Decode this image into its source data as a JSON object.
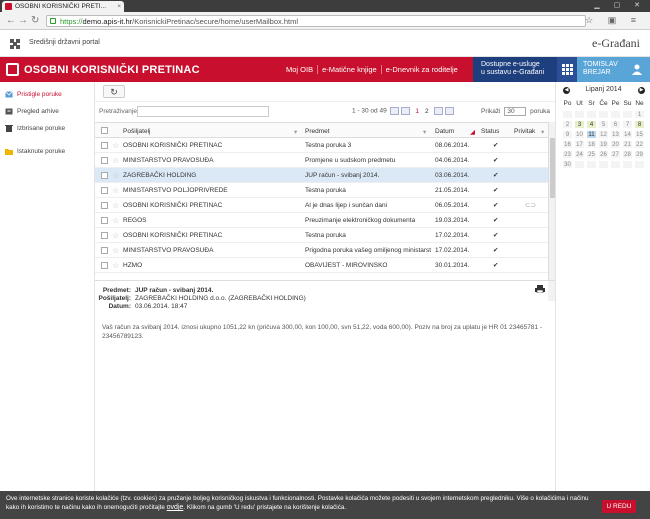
{
  "browser": {
    "tab_title": "OSOBNI KORISNIČKI PRETI...",
    "url_scheme": "https://",
    "url_host": "demo.apis-it.hr",
    "url_path": "/KorisnickiPretinac/secure/home/userMailbox.html"
  },
  "portal": {
    "name": "Središnji državni portal",
    "brand": "e-Građani"
  },
  "header": {
    "title": "OSOBNI KORISNIČKI PRETINAC",
    "links": [
      "Moj OIB",
      "e-Matične knjige",
      "e-Dnevnik za roditelje"
    ],
    "services_line1": "Dostupne e-usluge",
    "services_line2": "u sustavu e-Građani",
    "user_first": "TOMISLAV",
    "user_last": "BREJAR"
  },
  "sidebar": {
    "items": [
      {
        "label": "Pristigle poruke",
        "icon": "envelope-icon"
      },
      {
        "label": "Pregled arhive",
        "icon": "archive-icon"
      },
      {
        "label": "Izbrisane poruke",
        "icon": "trash-icon"
      },
      {
        "label": "Istaknute poruke",
        "icon": "folder-icon"
      }
    ]
  },
  "search": {
    "label": "Pretraživanje:",
    "placeholder": ""
  },
  "pager": {
    "range": "1 - 30 od 49",
    "page1": "1",
    "page2": "2",
    "show_label": "Prikaži",
    "show_value": "30",
    "show_unit": "poruka"
  },
  "table": {
    "columns": [
      "Pošiljatelj",
      "Predmet",
      "Datum",
      "Status",
      "Privitak"
    ],
    "rows": [
      {
        "sender": "OSOBNI KORISNIČKI PRETINAC",
        "subject": "Testna poruka 3",
        "date": "08.06.2014.",
        "status": "✔",
        "attach": "",
        "selected": false
      },
      {
        "sender": "MINISTARSTVO PRAVOSUĐA",
        "subject": "Promjene u sudskom predmetu",
        "date": "04.06.2014.",
        "status": "✔",
        "attach": "",
        "selected": false
      },
      {
        "sender": "ZAGREBAČKI HOLDING",
        "subject": "JUP račun - svibanj 2014.",
        "date": "03.06.2014.",
        "status": "✔",
        "attach": "",
        "selected": true
      },
      {
        "sender": "MINISTARSTVO POLJOPRIVREDE",
        "subject": "Testna poruka",
        "date": "21.05.2014.",
        "status": "✔",
        "attach": "",
        "selected": false
      },
      {
        "sender": "OSOBNI KORISNIČKI PRETINAC",
        "subject": "Al je dnas lijep i sunčan dani",
        "date": "06.05.2014.",
        "status": "✔",
        "attach": "⊂⊃",
        "selected": false
      },
      {
        "sender": "REGOS",
        "subject": "Preuzimanje elektroničkog dokumenta",
        "date": "19.03.2014.",
        "status": "✔",
        "attach": "",
        "selected": false
      },
      {
        "sender": "OSOBNI KORISNIČKI PRETINAC",
        "subject": "Testna poruka",
        "date": "17.02.2014.",
        "status": "✔",
        "attach": "",
        "selected": false
      },
      {
        "sender": "MINISTARSTVO PRAVOSUĐA",
        "subject": "Prigodna poruka vašeg omiljenog ministarstva",
        "date": "17.02.2014.",
        "status": "✔",
        "attach": "",
        "selected": false
      },
      {
        "sender": "HZMO",
        "subject": "OBAVIJEST - MIROVINSKO",
        "date": "30.01.2014.",
        "status": "✔",
        "attach": "",
        "selected": false
      }
    ]
  },
  "preview": {
    "subject_label": "Predmet:",
    "subject": "JUP račun - svibanj 2014.",
    "sender_label": "Pošiljatelj:",
    "sender": "ZAGREBAČKI HOLDING d.o.o. (ZAGREBAČKI HOLDING)",
    "date_label": "Datum:",
    "date": "03.06.2014. 18:47",
    "body": "Vaš račun za svibanj 2014. iznosi ukupno 1051,22 kn (pričuva 300,00, kon 100,00, svn 51,22, voda 600,00). Poziv na broj za uplatu je HR 01 23465781 - 23456789123."
  },
  "calendar": {
    "month": "Lipanj 2014",
    "days": [
      "Po",
      "Ut",
      "Sr",
      "Če",
      "Pe",
      "Su",
      "Ne"
    ],
    "weeks": [
      [
        "",
        "",
        "",
        "",
        "",
        "",
        "1"
      ],
      [
        "2",
        "3",
        "4",
        "5",
        "6",
        "7",
        "8"
      ],
      [
        "9",
        "10",
        "11",
        "12",
        "13",
        "14",
        "15"
      ],
      [
        "16",
        "17",
        "18",
        "19",
        "20",
        "21",
        "22"
      ],
      [
        "23",
        "24",
        "25",
        "26",
        "27",
        "28",
        "29"
      ],
      [
        "30",
        "",
        "",
        "",
        "",
        "",
        ""
      ]
    ],
    "highlight": [
      "3",
      "4",
      "8"
    ],
    "today": "11"
  },
  "cookie": {
    "text_a": "Ove internetske stranice koriste kolačiće (tzv. cookies) za pružanje boljeg korisničkog iskustva i funkcionalnosti. Postavke kolačića možete podesiti u svojem internetskom pregledniku. Više o kolačićima i načinu kako ih koristimo te načinu kako ih onemogućiti pročitajte",
    "link": "ovdje",
    "text_b": ". Klikom na gumb 'U redu' pristajete na korištenje kolačića.",
    "button": "U REDU"
  }
}
